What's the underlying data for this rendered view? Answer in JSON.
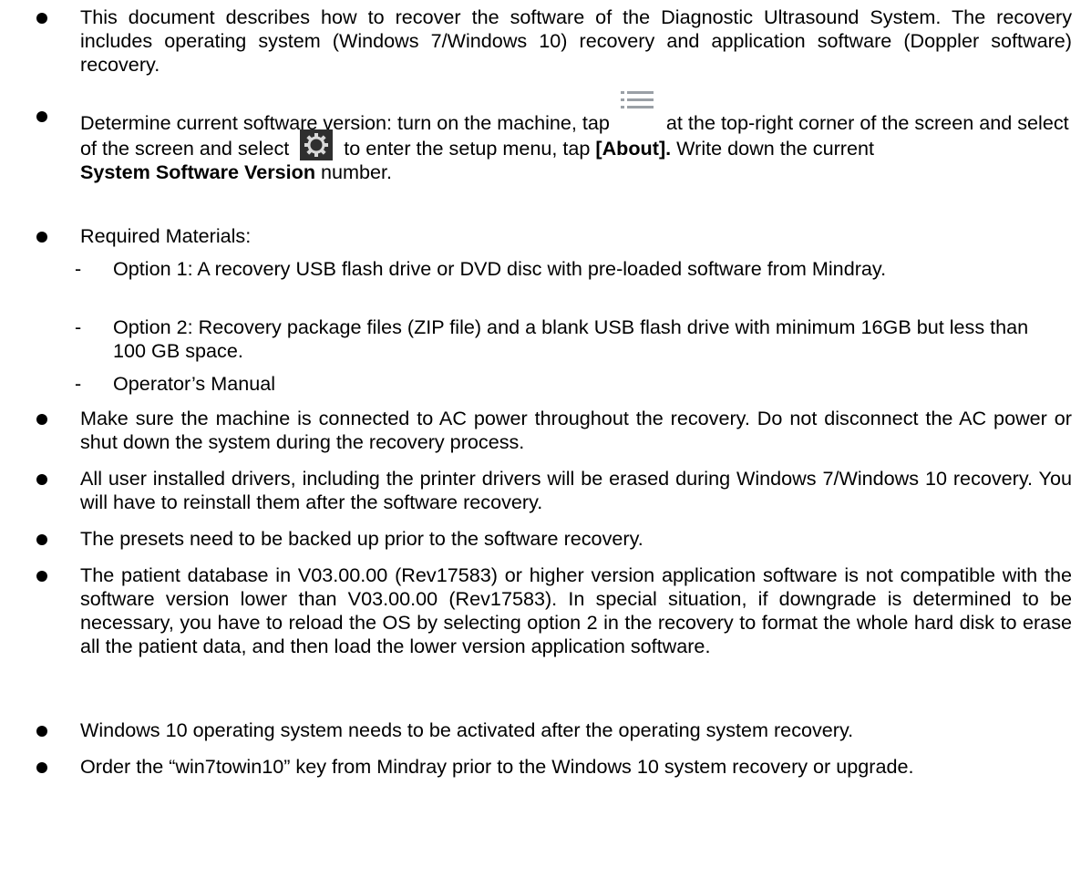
{
  "bullets": [
    {
      "text": "This document describes how to recover the software of the Diagnostic Ultrasound System. The recovery includes operating system (Windows 7/Windows 10) recovery and application software (Doppler software) recovery."
    },
    {
      "part1": "Determine current software version: turn on the machine, tap",
      "part2": "at the top-right corner of the screen and select",
      "part3": "to enter the setup menu, tap",
      "bold1": "[About].",
      "part4": "Write down the current",
      "bold2": "System Software Version",
      "part5": "number.",
      "icon1": "menu-list-icon",
      "icon2": "gear-settings-icon"
    },
    {
      "text": "Required Materials:",
      "subitems": [
        {
          "dash": "-",
          "text": "Option 1: A recovery USB flash drive or DVD disc with pre-loaded software from Mindray."
        },
        {
          "dash": "-",
          "text": "Option 2: Recovery package files (ZIP file) and a blank USB flash drive with minimum 16GB but less than 100 GB space."
        },
        {
          "dash": "-",
          "text": "Operator’s Manual"
        }
      ]
    },
    {
      "text": "Make sure the machine is connected to AC power throughout the recovery. Do not disconnect the AC power or shut down the system during the recovery process."
    },
    {
      "text": "All user installed drivers, including the printer drivers will be erased during Windows 7/Windows 10 recovery. You will have to reinstall them after the software recovery."
    },
    {
      "text": "The presets need to be backed up prior to the software recovery."
    },
    {
      "text": "The patient database in V03.00.00 (Rev17583) or higher version application software is not compatible with the software version lower than V03.00.00 (Rev17583). In special situation, if downgrade is determined to be necessary, you have to reload the OS by selecting option 2 in the recovery to format the whole hard disk to erase all the patient data, and then load the lower version application software."
    },
    {
      "text": "Windows 10 operating system needs to be activated after the operating system recovery."
    },
    {
      "text": "Order the “win7towin10” key from Mindray prior to the Windows 10 system recovery or upgrade."
    }
  ]
}
